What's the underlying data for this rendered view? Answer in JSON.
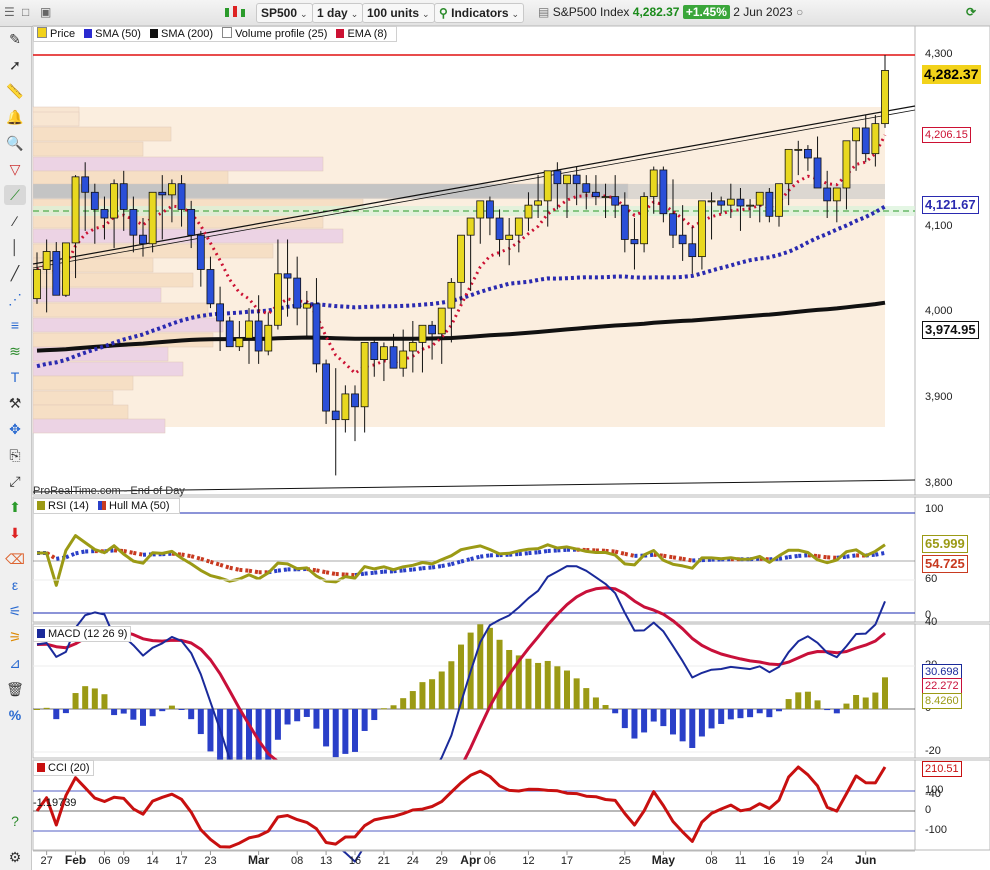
{
  "toolbar": {
    "symbol": "SP500",
    "interval": "1 day",
    "units": "100 units",
    "indicators_label": "Indicators",
    "instrument_name": "S&P500 Index",
    "last_price": "4,282.37",
    "change_pct": "+1.45%",
    "date": "2 Jun 2023"
  },
  "price_panel": {
    "legend": [
      "Price",
      "SMA (50)",
      "SMA (200)",
      "Volume profile (25)",
      "EMA (8)"
    ],
    "legend_colors": [
      "#f2d21a",
      "#2a2ad0",
      "#111111",
      "#ffffff",
      "#cc1133"
    ],
    "watermark": "ProRealTime.com - End of Day",
    "y_ticks": [
      "4,300",
      "4,100",
      "4,000",
      "3,900",
      "3,800"
    ],
    "labels": {
      "last": "4,282.37",
      "ema": "4,206.15",
      "sma50": "4,121.67",
      "sma200": "3,974.95"
    }
  },
  "rsi_panel": {
    "legend": [
      "RSI (14)",
      "Hull MA (50)"
    ],
    "y_ticks": [
      "100",
      "50",
      "0"
    ],
    "labels": {
      "rsi": "65.999",
      "hull": "54.725"
    }
  },
  "macd_panel": {
    "legend": "MACD (12 26 9)",
    "y_ticks": [
      "60",
      "40",
      "20",
      "0",
      "-20",
      "-40"
    ],
    "labels": {
      "macd": "30.698",
      "signal": "22.272",
      "hist": "8.4260"
    }
  },
  "cci_panel": {
    "legend": "CCI (20)",
    "y_ticks": [
      "200",
      "100",
      "0",
      "-100"
    ],
    "labels": {
      "cci": "210.51",
      "start": "-1.19739"
    }
  },
  "x_axis": [
    "27",
    "Feb",
    "06",
    "09",
    "14",
    "17",
    "23",
    "Mar",
    "08",
    "13",
    "16",
    "21",
    "24",
    "29",
    "Apr",
    "06",
    "12",
    "17",
    "25",
    "May",
    "08",
    "11",
    "16",
    "19",
    "24",
    "Jun"
  ],
  "colors": {
    "up_candle": "#e8d820",
    "down_candle": "#2a4fd8",
    "ema": "#cc1133",
    "sma50": "#2a2ab0",
    "sma200": "#111111",
    "rsi": "#9b9a15",
    "hull_up": "#2a3fc8",
    "hull_down": "#c83a20",
    "macd": "#1a2a9a",
    "signal": "#c8103a",
    "cci": "#c81010",
    "resistance": "#e01010"
  },
  "chart_data": {
    "type": "candlestick",
    "x": [
      "2023-01-26",
      "2023-01-27",
      "2023-01-30",
      "2023-01-31",
      "2023-02-01",
      "2023-02-02",
      "2023-02-03",
      "2023-02-06",
      "2023-02-07",
      "2023-02-08",
      "2023-02-09",
      "2023-02-10",
      "2023-02-13",
      "2023-02-14",
      "2023-02-15",
      "2023-02-16",
      "2023-02-17",
      "2023-02-21",
      "2023-02-22",
      "2023-02-23",
      "2023-02-24",
      "2023-02-27",
      "2023-02-28",
      "2023-03-01",
      "2023-03-02",
      "2023-03-03",
      "2023-03-06",
      "2023-03-07",
      "2023-03-08",
      "2023-03-09",
      "2023-03-10",
      "2023-03-13",
      "2023-03-14",
      "2023-03-15",
      "2023-03-16",
      "2023-03-17",
      "2023-03-20",
      "2023-03-21",
      "2023-03-22",
      "2023-03-23",
      "2023-03-24",
      "2023-03-27",
      "2023-03-28",
      "2023-03-29",
      "2023-03-30",
      "2023-03-31",
      "2023-04-03",
      "2023-04-04",
      "2023-04-05",
      "2023-04-06",
      "2023-04-10",
      "2023-04-11",
      "2023-04-12",
      "2023-04-13",
      "2023-04-14",
      "2023-04-17",
      "2023-04-18",
      "2023-04-19",
      "2023-04-20",
      "2023-04-21",
      "2023-04-24",
      "2023-04-25",
      "2023-04-26",
      "2023-04-27",
      "2023-04-28",
      "2023-05-01",
      "2023-05-02",
      "2023-05-03",
      "2023-05-04",
      "2023-05-05",
      "2023-05-08",
      "2023-05-09",
      "2023-05-10",
      "2023-05-11",
      "2023-05-12",
      "2023-05-15",
      "2023-05-16",
      "2023-05-17",
      "2023-05-18",
      "2023-05-19",
      "2023-05-22",
      "2023-05-23",
      "2023-05-24",
      "2023-05-25",
      "2023-05-26",
      "2023-05-30",
      "2023-05-31",
      "2023-06-01",
      "2023-06-02"
    ],
    "open": [
      4016,
      4050,
      4071,
      4020,
      4081,
      4158,
      4140,
      4120,
      4110,
      4150,
      4120,
      4090,
      4080,
      4140,
      4137,
      4150,
      4120,
      4090,
      4050,
      4010,
      3990,
      3960,
      3970,
      3990,
      3955,
      3985,
      4045,
      4040,
      4005,
      4010,
      3940,
      3885,
      3875,
      3905,
      3890,
      3965,
      3945,
      3960,
      3935,
      3955,
      3965,
      3985,
      3975,
      4005,
      4035,
      4090,
      4110,
      4130,
      4110,
      4085,
      4090,
      4110,
      4125,
      4130,
      4165,
      4150,
      4160,
      4150,
      4140,
      4135,
      4135,
      4125,
      4085,
      4080,
      4135,
      4166,
      4115,
      4090,
      4080,
      4065,
      4130,
      4130,
      4125,
      4132,
      4124,
      4125,
      4140,
      4112,
      4150,
      4190,
      4190,
      4180,
      4145,
      4130,
      4145,
      4200,
      4215,
      4185,
      4220
    ],
    "high": [
      4070,
      4085,
      4082,
      4062,
      4160,
      4175,
      4150,
      4135,
      4155,
      4165,
      4135,
      4110,
      4140,
      4160,
      4155,
      4160,
      4130,
      4095,
      4065,
      4030,
      3995,
      3990,
      4005,
      4020,
      4000,
      4085,
      4085,
      4065,
      4025,
      4040,
      3945,
      3935,
      3915,
      3915,
      3960,
      3970,
      3965,
      3975,
      3980,
      3990,
      3975,
      3990,
      4005,
      4040,
      4050,
      4110,
      4120,
      4135,
      4120,
      4110,
      4110,
      4140,
      4160,
      4155,
      4175,
      4160,
      4170,
      4160,
      4160,
      4150,
      4160,
      4140,
      4110,
      4140,
      4170,
      4170,
      4155,
      4125,
      4100,
      4130,
      4140,
      4135,
      4150,
      4145,
      4132,
      4140,
      4145,
      4140,
      4165,
      4200,
      4195,
      4205,
      4165,
      4140,
      4150,
      4215,
      4230,
      4230,
      4300
    ],
    "low": [
      4010,
      4000,
      4020,
      4018,
      4040,
      4095,
      4080,
      4085,
      4075,
      4095,
      4070,
      4065,
      4070,
      4085,
      4105,
      4100,
      4075,
      4030,
      4005,
      3955,
      3965,
      3955,
      3940,
      3940,
      3950,
      3980,
      3995,
      3985,
      3970,
      3930,
      3870,
      3810,
      3860,
      3850,
      3860,
      3925,
      3920,
      3935,
      3925,
      3930,
      3930,
      3945,
      3940,
      3965,
      4010,
      4025,
      4080,
      4090,
      4065,
      4055,
      4070,
      4095,
      4110,
      4100,
      4120,
      4110,
      4125,
      4120,
      4125,
      4110,
      4110,
      4070,
      4050,
      4070,
      4115,
      4105,
      4075,
      4060,
      4045,
      4050,
      4085,
      4115,
      4110,
      4095,
      4110,
      4105,
      4105,
      4100,
      4125,
      4160,
      4165,
      4155,
      4110,
      4105,
      4120,
      4165,
      4175,
      4170,
      4215
    ],
    "close": [
      4050,
      4071,
      4020,
      4081,
      4158,
      4140,
      4120,
      4110,
      4150,
      4120,
      4090,
      4080,
      4140,
      4137,
      4150,
      4120,
      4090,
      4050,
      4010,
      3990,
      3960,
      3970,
      3990,
      3955,
      3985,
      4045,
      4040,
      4005,
      4010,
      3940,
      3885,
      3875,
      3905,
      3890,
      3965,
      3945,
      3960,
      3935,
      3955,
      3965,
      3985,
      3975,
      4005,
      4035,
      4090,
      4110,
      4130,
      4110,
      4085,
      4090,
      4110,
      4125,
      4130,
      4165,
      4150,
      4160,
      4150,
      4140,
      4135,
      4135,
      4125,
      4085,
      4080,
      4135,
      4166,
      4115,
      4090,
      4080,
      4065,
      4130,
      4130,
      4125,
      4132,
      4124,
      4125,
      4140,
      4112,
      4150,
      4190,
      4190,
      4180,
      4145,
      4130,
      4145,
      4200,
      4215,
      4185,
      4220,
      4282
    ]
  }
}
